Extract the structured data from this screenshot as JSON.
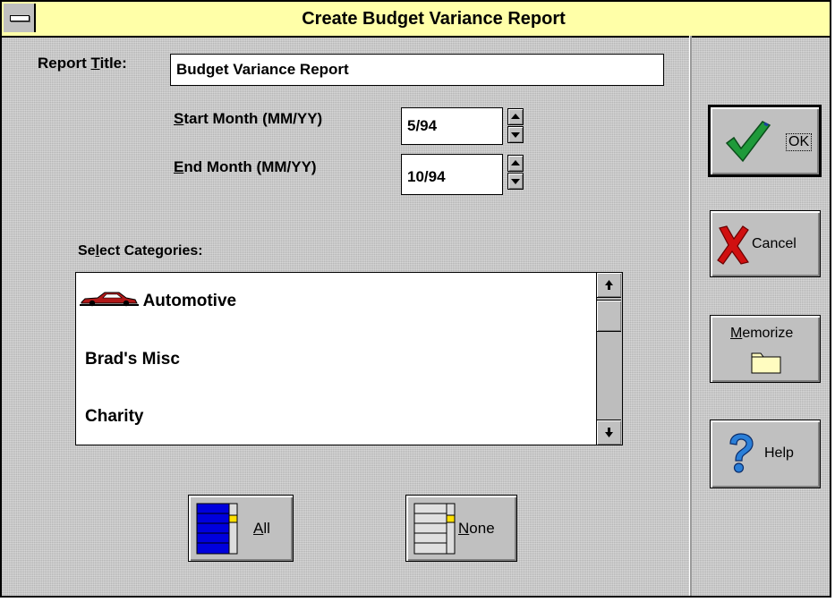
{
  "window": {
    "title": "Create Budget Variance Report"
  },
  "form": {
    "report_title_label_pre": "Report ",
    "report_title_label_u": "T",
    "report_title_label_post": "itle:",
    "report_title_value": "Budget Variance Report",
    "start_label_u": "S",
    "start_label_post": "tart Month (MM/YY)",
    "start_value": "5/94",
    "end_label_u": "E",
    "end_label_post": "nd Month (MM/YY)",
    "end_value": "10/94",
    "categories_label_pre": "Se",
    "categories_label_u": "l",
    "categories_label_post": "ect Categories:"
  },
  "categories": {
    "items": [
      {
        "label": "Automotive",
        "icon": "car-icon"
      },
      {
        "label": "Brad's Misc"
      },
      {
        "label": "Charity"
      }
    ]
  },
  "buttons": {
    "all_u": "A",
    "all_post": "ll",
    "none_u": "N",
    "none_post": "one",
    "ok_label": "OK",
    "cancel_label": "Cancel",
    "memorize_u": "M",
    "memorize_post": "emorize",
    "help_label": "Help"
  },
  "colors": {
    "titlebar": "#ffffa8",
    "ok_check": "#1f9a3a",
    "cancel_x": "#d01010",
    "help_q": "#2a7fd8",
    "select_all_blue": "#0000dd"
  }
}
